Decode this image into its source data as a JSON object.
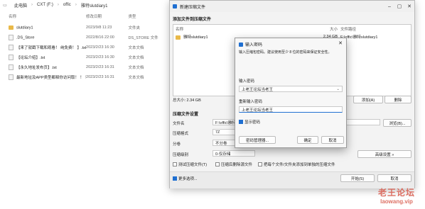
{
  "explorer": {
    "breadcrumb": [
      "此电脑",
      "CXT (F:)",
      "offic",
      "雅特slutdiary1"
    ],
    "columns": [
      "名称",
      "修改日期",
      "类型"
    ],
    "files": [
      {
        "name": "slutdiary1",
        "date": "2023/9/8 11:23",
        "type": "文件夹",
        "icon": "folder"
      },
      {
        "name": ".DS_Store",
        "date": "2022/8/16 22:00",
        "type": "DS_STORE 文件",
        "icon": "file"
      },
      {
        "name": "【来了就戳下载和观看！ 纯免费！ 】.txt",
        "date": "2023/2/23 16:30",
        "type": "文本文档",
        "icon": "file"
      },
      {
        "name": "【论坛介绍】.txt",
        "date": "2023/2/23 16:30",
        "type": "文本文档",
        "icon": "file"
      },
      {
        "name": "【永久地址发布页】.txt",
        "date": "2023/2/23 16:31",
        "type": "文本文档",
        "icon": "file"
      },
      {
        "name": "最新地址及APP类型都释你访问取！ ！ ！",
        "date": "2023/2/23 16:31",
        "type": "文本文档",
        "icon": "file"
      }
    ]
  },
  "archive": {
    "title": "新建压缩文件",
    "add_section": "添加文件到压缩文件",
    "list_headers": {
      "name": "名称",
      "size": "大小",
      "path": "文件路径"
    },
    "list_items": [
      {
        "name": "雅特slutdiary1",
        "size": "2.34 GB",
        "path": "F:\\offic\\雅特slutdiary1"
      }
    ],
    "total": "总大小: 2.34 GB",
    "add_btn": "添加(A)",
    "delete_btn": "删除",
    "settings_section": "压缩文件设置",
    "rows": [
      {
        "label": "文件名",
        "value": "F:\\offic\\雅特"
      },
      {
        "label": "压缩格式",
        "value": "7Z"
      },
      {
        "label": "分卷",
        "value": "不分卷"
      },
      {
        "label": "压缩级别",
        "value": "0-仅存储"
      }
    ],
    "browse_btn": "浏览(B)...",
    "advanced_btn": "高级设置 »",
    "checks": [
      {
        "label": "测试压缩文件(T)",
        "checked": false
      },
      {
        "label": "压缩后删除源文件",
        "checked": false
      },
      {
        "label": "把每个文件/文件夹添加到单独的压缩文件",
        "checked": false
      }
    ],
    "more_options": "更多选项...",
    "start_btn": "开始(S)",
    "cancel_btn": "取消"
  },
  "password": {
    "title": "输入密码",
    "hint": "输入压缩包密码。建议使用至少 8 位的密码来保证安全性。",
    "enter_label": "输入密码",
    "enter_value": "上老王论坛当老王",
    "reenter_label": "重新输入密码",
    "reenter_value": "上老王论坛当老王",
    "show_label": "显示密码",
    "manager_btn": "密码管理器...",
    "ok_btn": "确定",
    "cancel_btn": "取消"
  },
  "watermark": {
    "line1": "老王论坛",
    "line2": "laowang.vip"
  },
  "colors": {
    "accent": "#1f6fd1",
    "watermark": "#d8584a"
  }
}
